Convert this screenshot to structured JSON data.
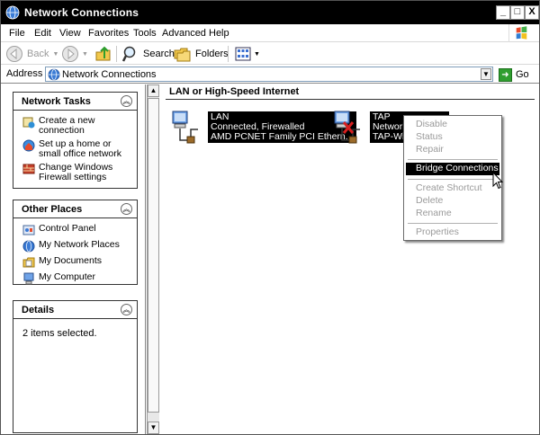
{
  "window": {
    "title": "Network Connections",
    "buttons": {
      "minimize": "_",
      "maximize": "□",
      "close": "X"
    }
  },
  "menu": [
    "File",
    "Edit",
    "View",
    "Favorites",
    "Tools",
    "Advanced",
    "Help"
  ],
  "toolbar": {
    "back": "Back",
    "search": "Search",
    "folders": "Folders"
  },
  "address": {
    "label": "Address",
    "value": "Network Connections",
    "go": "Go"
  },
  "left_pane": {
    "network_tasks": {
      "title": "Network Tasks",
      "items": [
        {
          "label": "Create a new connection",
          "icon": "new-connection-icon"
        },
        {
          "label": "Set up a home or small office network",
          "icon": "home-network-icon"
        },
        {
          "label": "Change Windows Firewall settings",
          "icon": "firewall-icon"
        }
      ]
    },
    "other_places": {
      "title": "Other Places",
      "items": [
        {
          "label": "Control Panel",
          "icon": "control-panel-icon"
        },
        {
          "label": "My Network Places",
          "icon": "network-places-icon"
        },
        {
          "label": "My Documents",
          "icon": "my-documents-icon"
        },
        {
          "label": "My Computer",
          "icon": "my-computer-icon"
        }
      ]
    },
    "details": {
      "title": "Details",
      "text": "2 items selected."
    }
  },
  "content": {
    "group_title": "LAN or High-Speed Internet",
    "connections": [
      {
        "name": "LAN",
        "status": "Connected, Firewalled",
        "device": "AMD PCNET Family PCI Ethern..."
      },
      {
        "name": "TAP",
        "status": "Network",
        "device": "TAP-Win3"
      }
    ]
  },
  "context_menu": {
    "items": [
      {
        "label": "Disable",
        "enabled": false
      },
      {
        "label": "Status",
        "enabled": false
      },
      {
        "label": "Repair",
        "enabled": false
      },
      {
        "label": "Bridge Connections",
        "enabled": true,
        "highlighted": true
      },
      {
        "label": "Create Shortcut",
        "enabled": false
      },
      {
        "label": "Delete",
        "enabled": false
      },
      {
        "label": "Rename",
        "enabled": false
      },
      {
        "label": "Properties",
        "enabled": false
      }
    ]
  }
}
